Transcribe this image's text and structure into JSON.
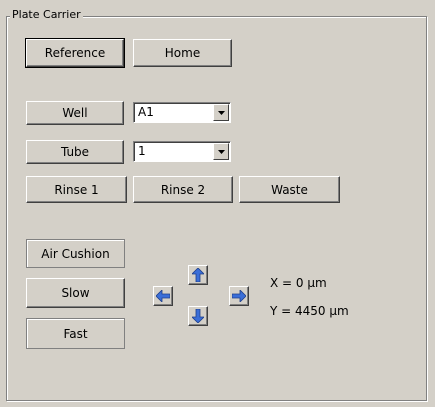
{
  "group": {
    "title": "Plate Carrier"
  },
  "buttons": {
    "reference": "Reference",
    "home": "Home",
    "well": "Well",
    "tube": "Tube",
    "rinse1": "Rinse 1",
    "rinse2": "Rinse 2",
    "waste": "Waste",
    "air_cushion": "Air Cushion",
    "slow": "Slow",
    "fast": "Fast"
  },
  "well_select": {
    "value": "A1"
  },
  "tube_select": {
    "value": "1"
  },
  "jog": {
    "icons": [
      "arrow-up-icon",
      "arrow-left-icon",
      "arrow-right-icon",
      "arrow-down-icon"
    ]
  },
  "position": {
    "x_text": "X = 0 µm",
    "y_text": "Y = 4450 µm"
  },
  "colors": {
    "background": "#d4d0c8",
    "arrow_blue": "#3a6ed8"
  }
}
